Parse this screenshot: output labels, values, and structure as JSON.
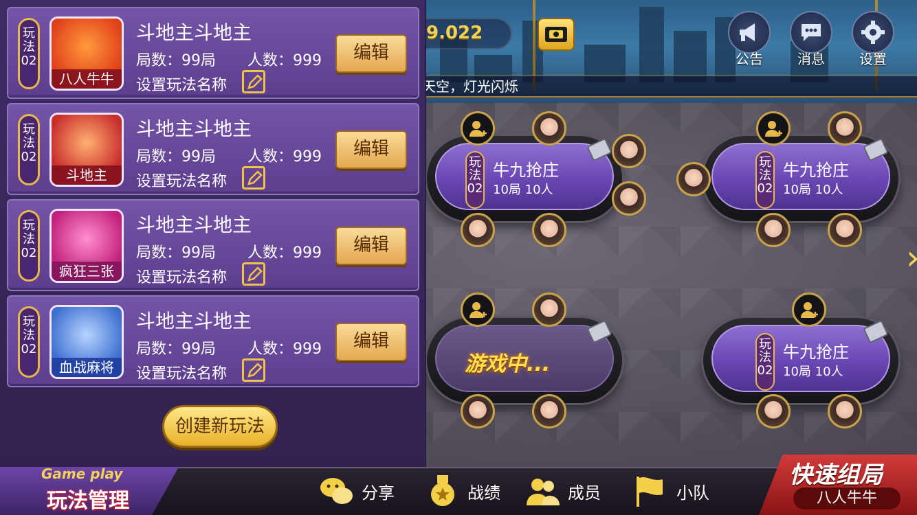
{
  "top": {
    "coin_value": "9.022",
    "icons": [
      {
        "label": "公告",
        "icon": "megaphone-icon"
      },
      {
        "label": "消息",
        "icon": "chat-icon"
      },
      {
        "label": "设置",
        "icon": "gear-icon"
      }
    ],
    "marquee": "天空，灯光闪烁"
  },
  "panel": {
    "modes": [
      {
        "tag": "玩法02",
        "icon_label": "八人牛牛",
        "title": "斗地主斗地主",
        "rounds": "局数：99局",
        "people": "人数：999",
        "set_name": "设置玩法名称",
        "edit": "编辑"
      },
      {
        "tag": "玩法02",
        "icon_label": "斗地主",
        "title": "斗地主斗地主",
        "rounds": "局数：99局",
        "people": "人数：999",
        "set_name": "设置玩法名称",
        "edit": "编辑"
      },
      {
        "tag": "玩法02",
        "icon_label": "疯狂三张",
        "title": "斗地主斗地主",
        "rounds": "局数：99局",
        "people": "人数：999",
        "set_name": "设置玩法名称",
        "edit": "编辑"
      },
      {
        "tag": "玩法02",
        "icon_label": "血战麻将",
        "title": "斗地主斗地主",
        "rounds": "局数：99局",
        "people": "人数：999",
        "set_name": "设置玩法名称",
        "edit": "编辑"
      }
    ],
    "create_label": "创建新玩法"
  },
  "tables": [
    {
      "tag": "玩法02",
      "name": "牛九抢庄",
      "info": "10局    10人"
    },
    {
      "tag": "玩法02",
      "name": "牛九抢庄",
      "info": "10局    10人"
    },
    {
      "playing": "游戏中..."
    },
    {
      "tag": "玩法02",
      "name": "牛九抢庄",
      "info": "10局    10人"
    }
  ],
  "bottom": {
    "mgmt_en": "Game play",
    "mgmt_cn": "玩法管理",
    "nav": [
      {
        "label": "分享",
        "icon": "wechat-icon"
      },
      {
        "label": "战绩",
        "icon": "medal-icon"
      },
      {
        "label": "成员",
        "icon": "members-icon"
      },
      {
        "label": "小队",
        "icon": "flag-icon"
      }
    ],
    "quick_title": "快速组局",
    "quick_sub": "八人牛牛"
  }
}
